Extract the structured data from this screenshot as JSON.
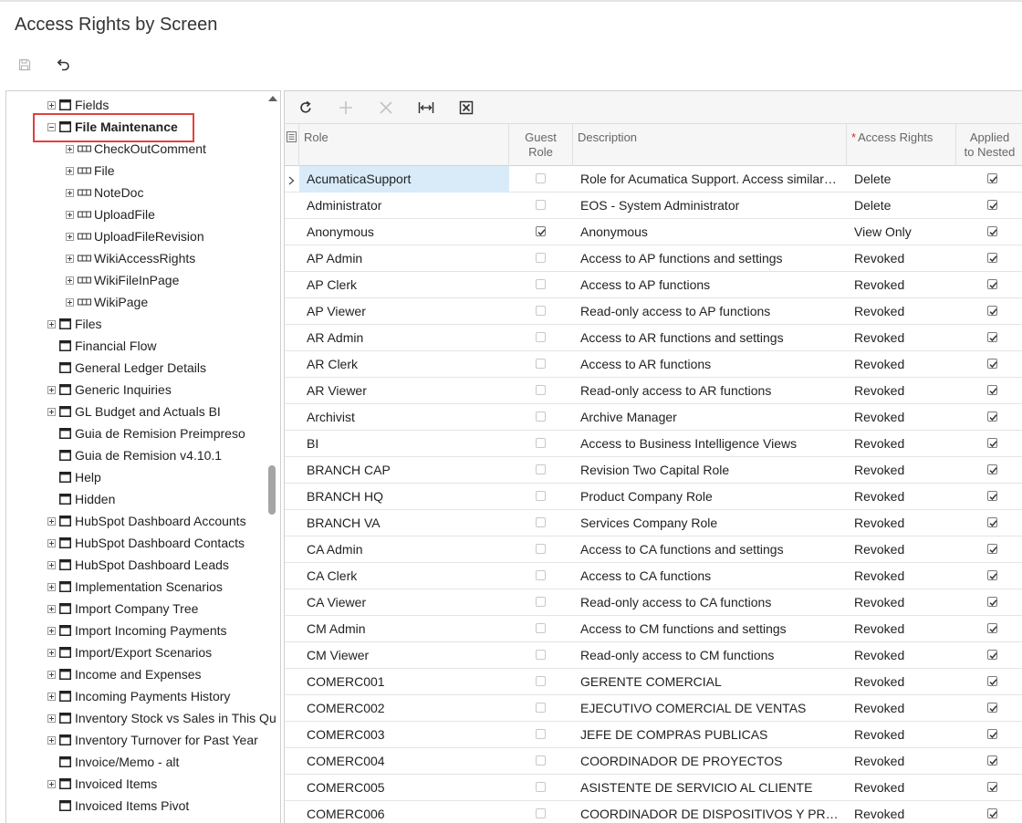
{
  "page": {
    "title": "Access Rights by Screen"
  },
  "page_toolbar": {
    "save_icon": "save-icon",
    "undo_icon": "undo-icon"
  },
  "tree": {
    "items": [
      {
        "label": "Fields",
        "expander": "plus",
        "type": "table"
      },
      {
        "label": "File Maintenance",
        "expander": "minus",
        "type": "table",
        "highlighted": true
      },
      {
        "label": "CheckOutComment",
        "expander": "plus",
        "type": "field"
      },
      {
        "label": "File",
        "expander": "plus",
        "type": "field"
      },
      {
        "label": "NoteDoc",
        "expander": "plus",
        "type": "field"
      },
      {
        "label": "UploadFile",
        "expander": "plus",
        "type": "field"
      },
      {
        "label": "UploadFileRevision",
        "expander": "plus",
        "type": "field"
      },
      {
        "label": "WikiAccessRights",
        "expander": "plus",
        "type": "field"
      },
      {
        "label": "WikiFileInPage",
        "expander": "plus",
        "type": "field"
      },
      {
        "label": "WikiPage",
        "expander": "plus",
        "type": "field"
      },
      {
        "label": "Files",
        "expander": "plus",
        "type": "table"
      },
      {
        "label": "Financial Flow",
        "expander": "none",
        "type": "table"
      },
      {
        "label": "General Ledger Details",
        "expander": "none",
        "type": "table"
      },
      {
        "label": "Generic Inquiries",
        "expander": "plus",
        "type": "table"
      },
      {
        "label": "GL Budget and Actuals BI",
        "expander": "plus",
        "type": "table"
      },
      {
        "label": "Guia de Remision Preimpreso",
        "expander": "none",
        "type": "table"
      },
      {
        "label": "Guia de Remision v4.10.1",
        "expander": "none",
        "type": "table"
      },
      {
        "label": "Help",
        "expander": "none",
        "type": "table"
      },
      {
        "label": "Hidden",
        "expander": "none",
        "type": "table"
      },
      {
        "label": "HubSpot Dashboard Accounts",
        "expander": "plus",
        "type": "table"
      },
      {
        "label": "HubSpot Dashboard Contacts",
        "expander": "plus",
        "type": "table"
      },
      {
        "label": "HubSpot Dashboard Leads",
        "expander": "plus",
        "type": "table"
      },
      {
        "label": "Implementation Scenarios",
        "expander": "plus",
        "type": "table"
      },
      {
        "label": "Import Company Tree",
        "expander": "plus",
        "type": "table"
      },
      {
        "label": "Import Incoming Payments",
        "expander": "plus",
        "type": "table"
      },
      {
        "label": "Import/Export Scenarios",
        "expander": "plus",
        "type": "table"
      },
      {
        "label": "Income and Expenses",
        "expander": "plus",
        "type": "table"
      },
      {
        "label": "Incoming Payments History",
        "expander": "plus",
        "type": "table"
      },
      {
        "label": "Inventory Stock vs Sales in This Qu",
        "expander": "plus",
        "type": "table"
      },
      {
        "label": "Inventory Turnover for Past Year",
        "expander": "plus",
        "type": "table"
      },
      {
        "label": "Invoice/Memo - alt",
        "expander": "none",
        "type": "table"
      },
      {
        "label": "Invoiced Items",
        "expander": "plus",
        "type": "table"
      },
      {
        "label": "Invoiced Items Pivot",
        "expander": "none",
        "type": "table"
      }
    ]
  },
  "grid_toolbar": {
    "refresh_icon": "refresh-icon",
    "add_icon": "plus-icon",
    "delete_icon": "x-icon",
    "fit_icon": "fit-columns-icon",
    "excel_icon": "excel-export-icon"
  },
  "grid": {
    "columns": {
      "role": "Role",
      "guest_role_1": "Guest",
      "guest_role_2": "Role",
      "description": "Description",
      "access_rights": "Access Rights",
      "applied_1": "Applied",
      "applied_2": "to Nested"
    },
    "rows": [
      {
        "role": "AcumaticaSupport",
        "guest": false,
        "description": "Role for Acumatica Support. Access similar to Administrator",
        "access": "Delete",
        "applied": true
      },
      {
        "role": "Administrator",
        "guest": false,
        "description": "EOS - System Administrator",
        "access": "Delete",
        "applied": true
      },
      {
        "role": "Anonymous",
        "guest": true,
        "description": "Anonymous",
        "access": "View Only",
        "applied": true
      },
      {
        "role": "AP Admin",
        "guest": false,
        "description": "Access to AP functions and settings",
        "access": "Revoked",
        "applied": true
      },
      {
        "role": "AP Clerk",
        "guest": false,
        "description": "Access to AP functions",
        "access": "Revoked",
        "applied": true
      },
      {
        "role": "AP Viewer",
        "guest": false,
        "description": "Read-only access to AP functions",
        "access": "Revoked",
        "applied": true
      },
      {
        "role": "AR Admin",
        "guest": false,
        "description": "Access to AR functions and settings",
        "access": "Revoked",
        "applied": true
      },
      {
        "role": "AR Clerk",
        "guest": false,
        "description": "Access to AR functions",
        "access": "Revoked",
        "applied": true
      },
      {
        "role": "AR Viewer",
        "guest": false,
        "description": "Read-only access to AR functions",
        "access": "Revoked",
        "applied": true
      },
      {
        "role": "Archivist",
        "guest": false,
        "description": "Archive Manager",
        "access": "Revoked",
        "applied": true
      },
      {
        "role": "BI",
        "guest": false,
        "description": "Access to Business Intelligence Views",
        "access": "Revoked",
        "applied": true
      },
      {
        "role": "BRANCH CAP",
        "guest": false,
        "description": "Revision Two Capital Role",
        "access": "Revoked",
        "applied": true
      },
      {
        "role": "BRANCH HQ",
        "guest": false,
        "description": "Product Company Role",
        "access": "Revoked",
        "applied": true
      },
      {
        "role": "BRANCH VA",
        "guest": false,
        "description": "Services Company Role",
        "access": "Revoked",
        "applied": true
      },
      {
        "role": "CA Admin",
        "guest": false,
        "description": "Access to CA functions and settings",
        "access": "Revoked",
        "applied": true
      },
      {
        "role": "CA Clerk",
        "guest": false,
        "description": "Access to CA functions",
        "access": "Revoked",
        "applied": true
      },
      {
        "role": "CA Viewer",
        "guest": false,
        "description": "Read-only access to CA functions",
        "access": "Revoked",
        "applied": true
      },
      {
        "role": "CM Admin",
        "guest": false,
        "description": "Access to CM functions and settings",
        "access": "Revoked",
        "applied": true
      },
      {
        "role": "CM Viewer",
        "guest": false,
        "description": "Read-only access to CM functions",
        "access": "Revoked",
        "applied": true
      },
      {
        "role": "COMERC001",
        "guest": false,
        "description": "GERENTE COMERCIAL",
        "access": "Revoked",
        "applied": true
      },
      {
        "role": "COMERC002",
        "guest": false,
        "description": "EJECUTIVO COMERCIAL DE VENTAS",
        "access": "Revoked",
        "applied": true
      },
      {
        "role": "COMERC003",
        "guest": false,
        "description": "JEFE DE COMPRAS PUBLICAS",
        "access": "Revoked",
        "applied": true
      },
      {
        "role": "COMERC004",
        "guest": false,
        "description": "COORDINADOR DE PROYECTOS",
        "access": "Revoked",
        "applied": true
      },
      {
        "role": "COMERC005",
        "guest": false,
        "description": "ASISTENTE DE SERVICIO AL CLIENTE",
        "access": "Revoked",
        "applied": true
      },
      {
        "role": "COMERC006",
        "guest": false,
        "description": "COORDINADOR DE DISPOSITIVOS Y PROTECCION",
        "access": "Revoked",
        "applied": true
      }
    ]
  }
}
